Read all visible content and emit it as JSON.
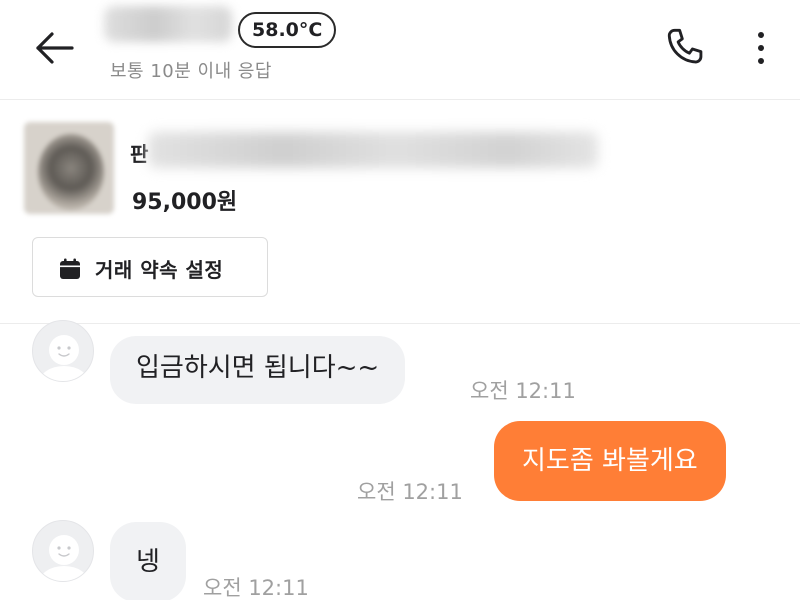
{
  "header": {
    "manner_temp": "58.0°C",
    "response_info": "보통 10분 이내 응답"
  },
  "product": {
    "title_visible_prefix": "판",
    "price": "95,000원",
    "promise_button_label": "거래 약속 설정"
  },
  "messages": [
    {
      "from": "other",
      "text": "입금하시면 됩니다~~",
      "time": "오전 12:11"
    },
    {
      "from": "me",
      "text": "지도좀 봐볼게요",
      "time": "오전 12:11"
    },
    {
      "from": "other",
      "text": "넹",
      "time": "오전 12:11"
    }
  ],
  "colors": {
    "accent": "#ff7e36",
    "incoming_bubble": "#f1f2f4",
    "muted_text": "#8a8a8a"
  },
  "icons": {
    "back": "arrow-left-icon",
    "call": "phone-icon",
    "more": "more-vertical-icon",
    "calendar": "calendar-icon",
    "avatar": "default-avatar-icon"
  }
}
